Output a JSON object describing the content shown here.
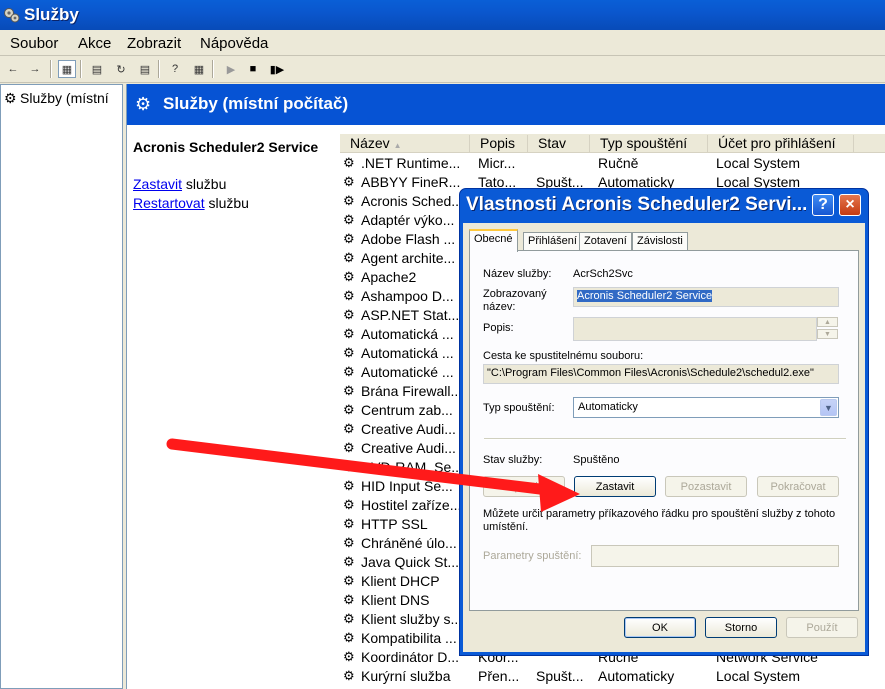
{
  "window": {
    "title": "Služby",
    "icon": "gear-services-icon"
  },
  "menu": {
    "items": [
      {
        "label": "Soubor",
        "accel": "S"
      },
      {
        "label": "Akce",
        "accel": "A"
      },
      {
        "label": "Zobrazit",
        "accel": "Z"
      },
      {
        "label": "Nápověda",
        "accel": "N"
      }
    ]
  },
  "toolbar": {
    "icons": [
      "back-arrow-icon",
      "forward-arrow-icon",
      "show-hide-tree-icon",
      "properties-icon",
      "refresh-icon",
      "export-list-icon",
      "help-icon",
      "console-tree-icon",
      "start-service-icon",
      "stop-service-icon",
      "pause-resume-icon"
    ]
  },
  "tree": {
    "root_label": "Služby (místní"
  },
  "banner": {
    "title": "Služby (místní počítač)"
  },
  "detail": {
    "service_name": "Acronis Scheduler2 Service",
    "stop_link": "Zastavit",
    "stop_suffix": " službu",
    "restart_link": "Restartovat",
    "restart_suffix": " službu"
  },
  "list": {
    "columns": [
      "Název",
      "Popis",
      "Stav",
      "Typ spouštění",
      "Účet pro přihlášení"
    ],
    "rows": [
      {
        "name": ".NET Runtime...",
        "desc": "Micr...",
        "state": "",
        "startup": "Ručně",
        "account": "Local System"
      },
      {
        "name": "ABBYY FineR...",
        "desc": "Tato...",
        "state": "Spušt...",
        "startup": "Automaticky",
        "account": "Local System"
      },
      {
        "name": "Acronis Sched...",
        "desc": "",
        "state": "",
        "startup": "",
        "account": ""
      },
      {
        "name": "Adaptér výko...",
        "desc": "",
        "state": "",
        "startup": "",
        "account": ""
      },
      {
        "name": "Adobe Flash ...",
        "desc": "",
        "state": "",
        "startup": "",
        "account": ""
      },
      {
        "name": "Agent archite...",
        "desc": "",
        "state": "",
        "startup": "",
        "account": ""
      },
      {
        "name": "Apache2",
        "desc": "",
        "state": "",
        "startup": "",
        "account": ""
      },
      {
        "name": "Ashampoo D...",
        "desc": "",
        "state": "",
        "startup": "",
        "account": ""
      },
      {
        "name": "ASP.NET Stat...",
        "desc": "",
        "state": "",
        "startup": "",
        "account": ""
      },
      {
        "name": "Automatická ...",
        "desc": "",
        "state": "",
        "startup": "",
        "account": ""
      },
      {
        "name": "Automatická ...",
        "desc": "",
        "state": "",
        "startup": "",
        "account": ""
      },
      {
        "name": "Automatické ...",
        "desc": "",
        "state": "",
        "startup": "",
        "account": ""
      },
      {
        "name": "Brána Firewall...",
        "desc": "",
        "state": "",
        "startup": "",
        "account": ""
      },
      {
        "name": "Centrum zab...",
        "desc": "",
        "state": "",
        "startup": "",
        "account": ""
      },
      {
        "name": "Creative Audi...",
        "desc": "",
        "state": "",
        "startup": "",
        "account": ""
      },
      {
        "name": "Creative Audi...",
        "desc": "",
        "state": "",
        "startup": "",
        "account": ""
      },
      {
        "name": "DVD-RAM_Se...",
        "desc": "",
        "state": "",
        "startup": "",
        "account": ""
      },
      {
        "name": "HID Input Se...",
        "desc": "",
        "state": "",
        "startup": "",
        "account": ""
      },
      {
        "name": "Hostitel zaříze...",
        "desc": "",
        "state": "",
        "startup": "",
        "account": ""
      },
      {
        "name": "HTTP SSL",
        "desc": "",
        "state": "",
        "startup": "",
        "account": ""
      },
      {
        "name": "Chráněné úlo...",
        "desc": "",
        "state": "",
        "startup": "",
        "account": ""
      },
      {
        "name": "Java Quick St...",
        "desc": "",
        "state": "",
        "startup": "",
        "account": ""
      },
      {
        "name": "Klient DHCP",
        "desc": "",
        "state": "",
        "startup": "",
        "account": ""
      },
      {
        "name": "Klient DNS",
        "desc": "",
        "state": "",
        "startup": "",
        "account": ""
      },
      {
        "name": "Klient služby s...",
        "desc": "",
        "state": "",
        "startup": "",
        "account": ""
      },
      {
        "name": "Kompatibilita ...",
        "desc": "",
        "state": "",
        "startup": "",
        "account": ""
      },
      {
        "name": "Koordinátor D...",
        "desc": "Koor...",
        "state": "",
        "startup": "Ručně",
        "account": "Network Service"
      },
      {
        "name": "Kurýrní služba",
        "desc": "Přen...",
        "state": "Spušt...",
        "startup": "Automaticky",
        "account": "Local System"
      }
    ]
  },
  "dialog": {
    "title": "Vlastnosti Acronis Scheduler2 Servi...",
    "help_glyph": "?",
    "close_glyph": "×",
    "tabs": [
      "Obecné",
      "Přihlášení",
      "Zotavení",
      "Závislosti"
    ],
    "service_name_label": "Název služby:",
    "service_name_value": "AcrSch2Svc",
    "display_name_label_1": "Zobrazovaný",
    "display_name_label_2": "název:",
    "display_name_value": "Acronis Scheduler2 Service",
    "description_label": "Popis:",
    "description_value": "",
    "path_label": "Cesta ke spustitelnému souboru:",
    "path_value": "\"C:\\Program Files\\Common Files\\Acronis\\Schedule2\\schedul2.exe\"",
    "startup_type_label": "Typ spouštění:",
    "startup_type_value": "Automaticky",
    "status_label": "Stav služby:",
    "status_value": "Spuštěno",
    "btn_start": "Spustit",
    "btn_stop": "Zastavit",
    "btn_pause": "Pozastavit",
    "btn_resume": "Pokračovat",
    "params_note_1": "Můžete určit parametry příkazového řádku pro spouštění služby z tohoto",
    "params_note_2": "umístění.",
    "params_label": "Parametry spuštění:",
    "params_value": "",
    "btn_ok": "OK",
    "btn_cancel": "Storno",
    "btn_apply": "Použít"
  },
  "colors": {
    "xp_blue": "#0a5ad6",
    "annotation_red": "#ff1a1a",
    "selection": "#316ac5"
  }
}
